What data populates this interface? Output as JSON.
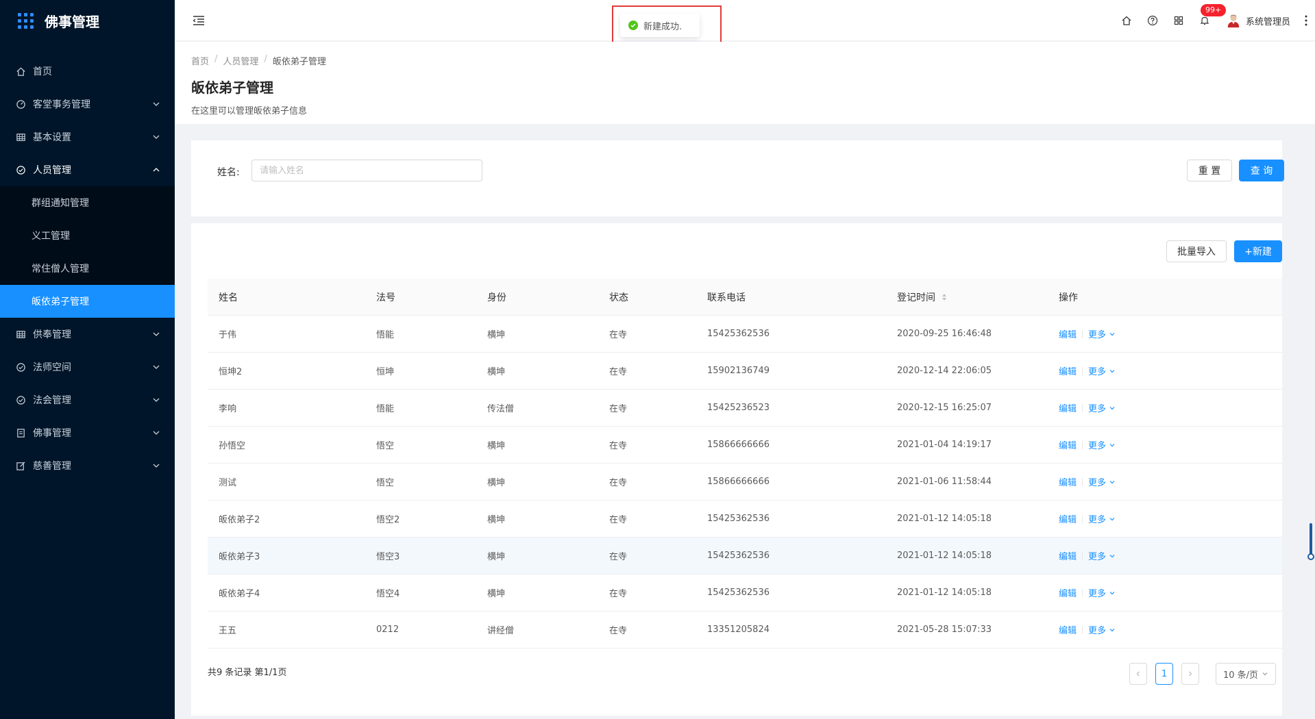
{
  "app": {
    "title": "佛事管理"
  },
  "sidebar": {
    "items": [
      {
        "label": "首页",
        "icon": "home-icon"
      },
      {
        "label": "客堂事务管理",
        "icon": "dashboard-icon"
      },
      {
        "label": "基本设置",
        "icon": "table-icon"
      },
      {
        "label": "人员管理",
        "icon": "check-circle-icon"
      }
    ],
    "sub_items": [
      {
        "label": "群组通知管理"
      },
      {
        "label": "义工管理"
      },
      {
        "label": "常住僧人管理"
      },
      {
        "label": "皈依弟子管理"
      }
    ],
    "items_after": [
      {
        "label": "供奉管理",
        "icon": "table-icon"
      },
      {
        "label": "法师空间",
        "icon": "check-circle-icon"
      },
      {
        "label": "法会管理",
        "icon": "check-circle-icon"
      },
      {
        "label": "佛事管理",
        "icon": "document-icon"
      },
      {
        "label": "慈善管理",
        "icon": "edit-icon"
      }
    ]
  },
  "header": {
    "badge": "99+",
    "user_name": "系统管理员"
  },
  "toast": {
    "message": "新建成功."
  },
  "breadcrumb": [
    "首页",
    "人员管理",
    "皈依弟子管理"
  ],
  "page": {
    "title": "皈依弟子管理",
    "description": "在这里可以管理皈依弟子信息"
  },
  "search": {
    "label": "姓名:",
    "placeholder": "请输入姓名",
    "reset_label": "重 置",
    "query_label": "查 询"
  },
  "toolbar": {
    "import_label": "批量导入",
    "new_label": "+新建"
  },
  "table": {
    "columns": [
      "姓名",
      "法号",
      "身份",
      "状态",
      "联系电话",
      "登记时间",
      "操作"
    ],
    "rows": [
      {
        "name": "于伟",
        "dharma": "悟能",
        "identity": "横坤",
        "status": "在寺",
        "phone": "15425362536",
        "time": "2020-09-25 16:46:48"
      },
      {
        "name": "恒坤2",
        "dharma": "恒坤",
        "identity": "横坤",
        "status": "在寺",
        "phone": "15902136749",
        "time": "2020-12-14 22:06:05"
      },
      {
        "name": "李响",
        "dharma": "悟能",
        "identity": "传法僧",
        "status": "在寺",
        "phone": "15425236523",
        "time": "2020-12-15 16:25:07"
      },
      {
        "name": "孙悟空",
        "dharma": "悟空",
        "identity": "横坤",
        "status": "在寺",
        "phone": "15866666666",
        "time": "2021-01-04 14:19:17"
      },
      {
        "name": "测试",
        "dharma": "悟空",
        "identity": "横坤",
        "status": "在寺",
        "phone": "15866666666",
        "time": "2021-01-06 11:58:44"
      },
      {
        "name": "皈依弟子2",
        "dharma": "悟空2",
        "identity": "横坤",
        "status": "在寺",
        "phone": "15425362536",
        "time": "2021-01-12 14:05:18"
      },
      {
        "name": "皈依弟子3",
        "dharma": "悟空3",
        "identity": "横坤",
        "status": "在寺",
        "phone": "15425362536",
        "time": "2021-01-12 14:05:18"
      },
      {
        "name": "皈依弟子4",
        "dharma": "悟空4",
        "identity": "横坤",
        "status": "在寺",
        "phone": "15425362536",
        "time": "2021-01-12 14:05:18"
      },
      {
        "name": "王五",
        "dharma": "0212",
        "identity": "讲经僧",
        "status": "在寺",
        "phone": "13351205824",
        "time": "2021-05-28 15:07:33"
      }
    ],
    "edit_label": "编辑",
    "more_label": "更多"
  },
  "pagination": {
    "summary": "共9 条记录 第1/1页",
    "current_page": "1",
    "page_size": "10 条/页"
  },
  "colors": {
    "primary": "#1890ff",
    "sidebar_bg": "#001529",
    "success": "#52c41a",
    "badge": "#f5222d"
  }
}
